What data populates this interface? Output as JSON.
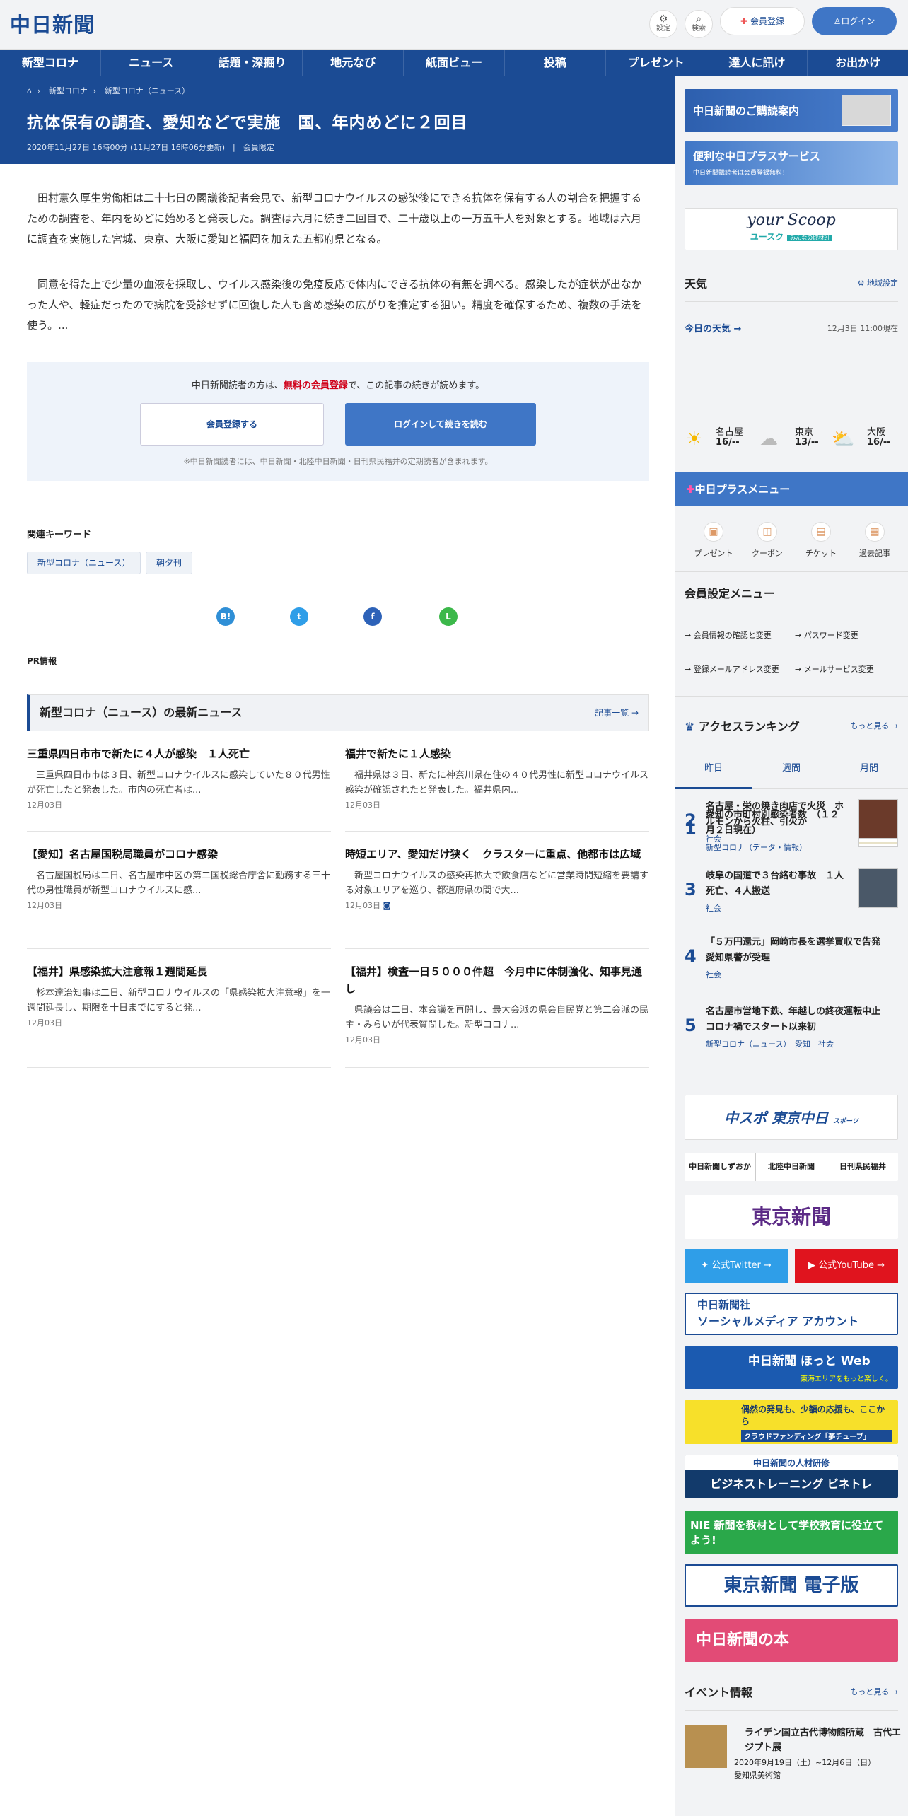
{
  "site": {
    "logo": "中日新聞",
    "settings": "設定",
    "search": "検索",
    "register": "会員登録",
    "login": "ログイン"
  },
  "nav": [
    "新型コロナ",
    "ニュース",
    "話題・深掘り",
    "地元なび",
    "紙面ビュー",
    "投稿",
    "プレゼント",
    "達人に訊け",
    "お出かけ"
  ],
  "breadcrumb": [
    "新型コロナ",
    "新型コロナ（ニュース）"
  ],
  "article": {
    "title": "抗体保有の調査、愛知などで実施　国、年内めどに２回目",
    "date": "2020年11月27日 16時00分 (11月27日 16時06分更新)",
    "badge": "会員限定",
    "p1": "田村憲久厚生労働相は二十七日の閣議後記者会見で、新型コロナウイルスの感染後にできる抗体を保有する人の割合を把握するための調査を、年内をめどに始めると発表した。調査は六月に続き二回目で、二十歳以上の一万五千人を対象とする。地域は六月に調査を実施した宮城、東京、大阪に愛知と福岡を加えた五都府県となる。",
    "p2": "同意を得た上で少量の血液を採取し、ウイルス感染後の免疫反応で体内にできる抗体の有無を調べる。感染したが症状が出なかった人や、軽症だったので病院を受診せずに回復した人も含め感染の広がりを推定する狙い。精度を確保するため、複数の手法を使う。..."
  },
  "login_box": {
    "text1": "中日新聞読者の方は、",
    "text_red": "無料の会員登録",
    "text2": "で、この記事の続きが読めます。",
    "register_btn": "会員登録する",
    "login_btn": "ログインして続きを読む",
    "note": "※中日新聞読者には、中日新聞・北陸中日新聞・日刊県民福井の定期読者が含まれます。"
  },
  "keywords": {
    "title": "関連キーワード",
    "items": [
      "新型コロナ（ニュース）",
      "朝夕刊"
    ]
  },
  "share": {
    "hatena": "B!",
    "twitter": "t",
    "facebook": "f",
    "line": "L"
  },
  "pr": "PR情報",
  "latest": {
    "title": "新型コロナ（ニュース）の最新ニュース",
    "more": "記事一覧",
    "items": [
      {
        "title": "三重県四日市市で新たに４人が感染　１人死亡",
        "body": "三重県四日市市は３日、新型コロナウイルスに感染していた８０代男性が死亡したと発表した。市内の死亡者は...",
        "date": "12月03日"
      },
      {
        "title": "福井で新たに１人感染",
        "body": "福井県は３日、新たに神奈川県在住の４０代男性に新型コロナウイルス感染が確認されたと発表した。福井県内...",
        "date": "12月03日"
      },
      {
        "title": "【愛知】名古屋国税局職員がコロナ感染",
        "body": "名古屋国税局は二日、名古屋市中区の第二国税総合庁舎に勤務する三十代の男性職員が新型コロナウイルスに感...",
        "date": "12月03日"
      },
      {
        "title": "時短エリア、愛知だけ狭く　クラスターに重点、他都市は広域",
        "body": "新型コロナウイルスの感染再拡大で飲食店などに営業時間短縮を要請する対象エリアを巡り、都道府県の間で大...",
        "date": "12月03日"
      },
      {
        "title": "【福井】県感染拡大注意報１週間延長",
        "body": "杉本達治知事は二日、新型コロナウイルスの「県感染拡大注意報」を一週間延長し、期限を十日までにすると発...",
        "date": "12月03日"
      },
      {
        "title": "【福井】検査一日５０００件超　今月中に体制強化、知事見通し",
        "body": "県議会は二日、本会議を再開し、最大会派の県会自民党と第二会派の民主・みらいが代表質問した。新型コロナ...",
        "date": "12月03日"
      }
    ]
  },
  "sidebar": {
    "banner1": "中日新聞のご購読案内",
    "banner2": "便利な中日プラスサービス",
    "banner2_sub": "中日新聞購読者は会員登録無料！",
    "banner3": "your Scoop",
    "banner3_sub": "ユースク",
    "banner3_note": "みんなの取材班",
    "weather_title": "天気",
    "weather_setting": "地域設定",
    "weather_today": "今日の天気",
    "weather_time": "12月3日 11:00現在",
    "weather": [
      {
        "city": "名古屋",
        "temp": "16/--"
      },
      {
        "city": "東京",
        "temp": "13/--"
      },
      {
        "city": "大阪",
        "temp": "16/--"
      }
    ],
    "plus_menu": "中日プラスメニュー",
    "plus_items": [
      "プレゼント",
      "クーポン",
      "チケット",
      "過去記事"
    ],
    "member_menu": "会員設定メニュー",
    "member_items": [
      "会員情報の確認と変更",
      "パスワード変更",
      "登録メールアドレス変更",
      "メールサービス変更"
    ],
    "ranking_title": "アクセスランキング",
    "ranking_more": "もっと見る",
    "ranking_tabs": [
      "昨日",
      "週間",
      "月間"
    ],
    "ranking": [
      {
        "n": "1",
        "title": "愛知の市町村別感染者数　（１２月２日現在）",
        "cat": "新型コロナ（データ・情報）"
      },
      {
        "n": "2",
        "title": "名古屋・栄の焼き肉店で火災　ホルモンから火柱、引火か",
        "cat": "社会"
      },
      {
        "n": "3",
        "title": "岐阜の国道で３台絡む事故　１人死亡、４人搬送",
        "cat": "社会"
      },
      {
        "n": "4",
        "title": "「５万円還元」岡崎市長を選挙買収で告発　愛知県警が受理",
        "cat": "社会"
      },
      {
        "n": "5",
        "title": "名古屋市営地下鉄、年越しの終夜運転中止　コロナ禍でスタート以来初",
        "cat": "新型コロナ（ニュース）　愛知　社会"
      }
    ],
    "chuspo": "中スポ 東京中日",
    "chuspo_sub": "スポーツ",
    "papers": [
      "中日新聞しずおか",
      "北陸中日新聞",
      "日刊県民福井"
    ],
    "tokyo": "東京新聞",
    "twitter": "公式Twitter",
    "youtube": "公式YouTube",
    "social": "中日新聞社",
    "social2": "ソーシャルメディア アカウント",
    "hotto": "中日新聞 ほっと Web",
    "hotto_sub": "東海エリアをもっと楽しく。",
    "cf": "偶然の発見も、少額の応援も、ここから",
    "cf_sub": "クラウドファンディング「夢チューブ」",
    "biz": "中日新聞の人材研修",
    "biz_sub": "ビジネストレーニング ビネトレ",
    "nie": "NIE 新聞を教材として学校教育に役立てよう!",
    "tokyo_e": "東京新聞 電子版",
    "book": "中日新聞の本",
    "event_title": "イベント情報",
    "event_more": "もっと見る",
    "event": {
      "title": "ライデン国立古代博物館所蔵　古代エジプト展",
      "date": "2020年9月19日（土）~12月6日（日）",
      "place": "愛知県美術館"
    }
  }
}
